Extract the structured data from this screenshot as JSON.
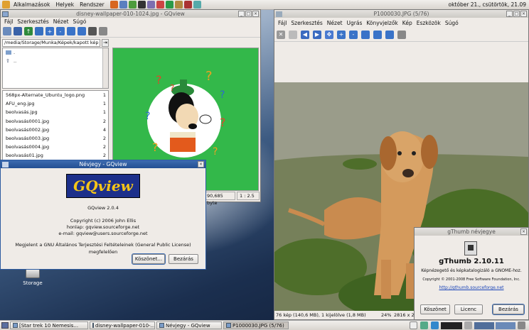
{
  "top_panel": {
    "menus": [
      "Alkalmazások",
      "Helyek",
      "Rendszer"
    ],
    "clock": "október 21., csütörtök, 21.09"
  },
  "desktop": {
    "icons": [
      {
        "label": "Storage",
        "icon": "drive-icon"
      }
    ]
  },
  "gqview": {
    "title": "disney-wallpaper-010-1024.jpg - GQview",
    "menu": [
      "Fájl",
      "Szerkesztés",
      "Nézet",
      "Súgó"
    ],
    "path": "/media/Storage/Munka/Képek/kapott kép",
    "dirs": [
      ".",
      ".."
    ],
    "files": [
      {
        "name": "568px-Alternate_Ubuntu_logo.png",
        "size": "1"
      },
      {
        "name": "AFU_eng.jpg",
        "size": "1"
      },
      {
        "name": "beolvasás.jpg",
        "size": "1"
      },
      {
        "name": "beolvasás0001.jpg",
        "size": "2"
      },
      {
        "name": "beolvasás0002.jpg",
        "size": "4"
      },
      {
        "name": "beolvasás0003.jpg",
        "size": "2"
      },
      {
        "name": "beolvasás0004.jpg",
        "size": "2"
      },
      {
        "name": "beolvasás01.jpg",
        "size": "2"
      }
    ],
    "status_size": "90,685 byte",
    "status_zoom": "1 : 2.5"
  },
  "gqview_about": {
    "title": "Névjegy - GQview",
    "logo_text": "GQview",
    "version": "GQview 2.0.4",
    "copyright": "Copyright (c) 2006 John Ellis",
    "homepage": "honlap: gqview.sourceforge.net",
    "email": "e-mail: gqview@users.sourceforge.net",
    "license": "Megjelent a GNU Általános Terjesztési Feltételeinek (General Public License) megfelelően",
    "thanks_button": "Köszönet...",
    "close_button": "Bezárás"
  },
  "gthumb": {
    "title": "P1000030.JPG  (5/76)",
    "menu": [
      "Fájl",
      "Szerkesztés",
      "Nézet",
      "Ugrás",
      "Könyvjelzők",
      "Kép",
      "Eszközök",
      "Súgó"
    ],
    "status_left": "76 kép (140,6 MB), 1 kijelölve (1,8 MB)",
    "status_zoom": "24%",
    "status_dims": "2816 x 2"
  },
  "gthumb_about": {
    "title": "gThumb névjegye",
    "app_name": "gThumb 2.10.11",
    "description": "Képnézegető és képkatalogizáló a GNOME-hoz.",
    "copyright": "Copyright © 2001-2008 Free Software Foundation, Inc.",
    "link": "http://gthumb.sourceforge.net",
    "credits_button": "Köszönet",
    "license_button": "Licenc",
    "close_button": "Bezárás"
  },
  "taskbar": {
    "tasks": [
      {
        "label": "[Star trek 10 Nemesis..."
      },
      {
        "label": "disney-wallpaper-010-..."
      },
      {
        "label": "Névjegy - GQview"
      },
      {
        "label": "P1000030.JPG  (5/76)"
      }
    ]
  },
  "colors": {
    "titlebar_active": "#2d5ba0",
    "goofy_bg": "#33b84a",
    "gqview_logo_bg": "#1c2f8a",
    "gqview_logo_text": "#f5c518"
  }
}
